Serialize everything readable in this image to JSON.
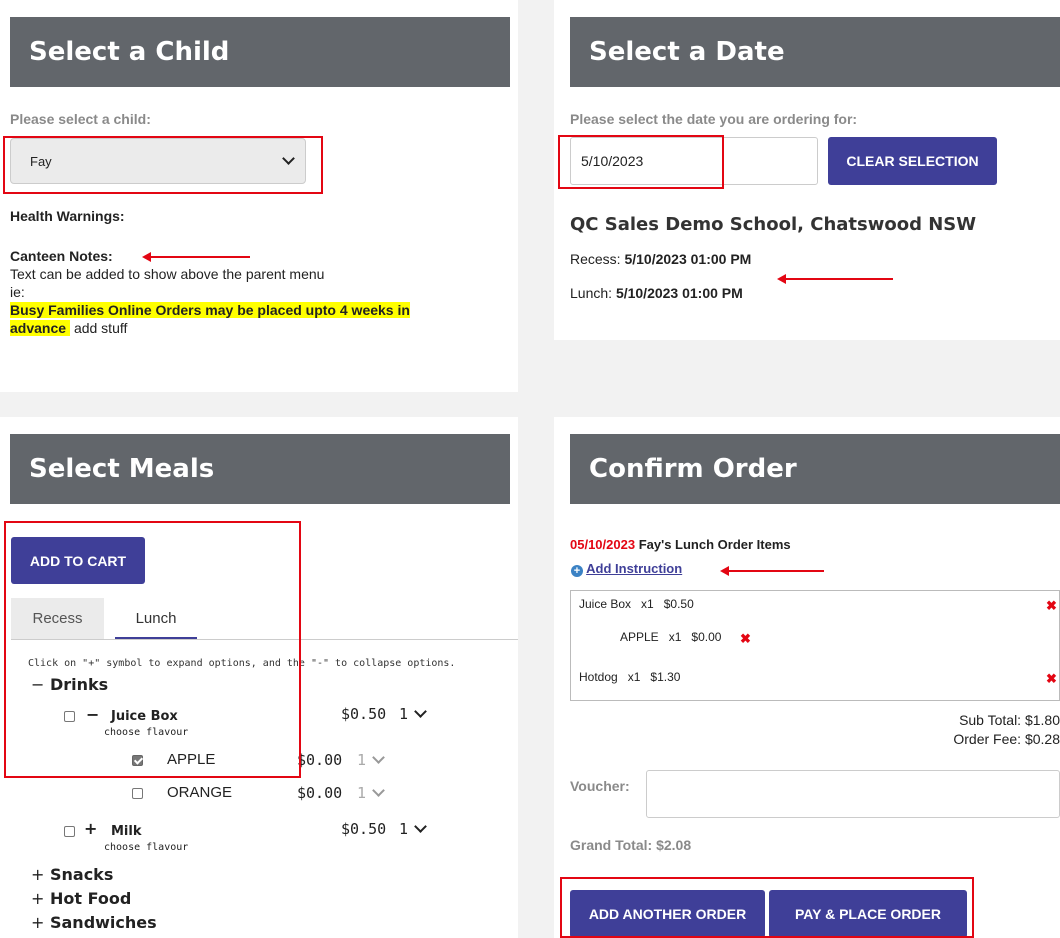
{
  "child_panel": {
    "title": "Select a Child",
    "prompt": "Please select a child:",
    "selected_child": "Fay",
    "health_label": "Health Warnings:",
    "notes_label": "Canteen Notes:",
    "notes_line1": "Text can be added to show above the parent menu",
    "notes_line2": "ie:",
    "highlight_line1": "Busy Families Online Orders may be placed upto 4 weeks in",
    "highlight_line2": "advance",
    "notes_tail": "add stuff"
  },
  "date_panel": {
    "title": "Select a Date",
    "prompt": "Please select the date you are ordering for:",
    "date_value": "5/10/2023",
    "clear_label": "CLEAR SELECTION",
    "school": "QC Sales Demo School, Chatswood NSW",
    "recess_label": "Recess:",
    "recess_value": "5/10/2023 01:00 PM",
    "lunch_label": "Lunch:",
    "lunch_value": "5/10/2023 01:00 PM"
  },
  "meals_panel": {
    "title": "Select Meals",
    "add_to_cart": "ADD TO CART",
    "tabs": [
      "Recess",
      "Lunch"
    ],
    "instructions": "Click on \"+\" symbol to expand options, and the \"-\" to collapse options.",
    "drinks": "Drinks",
    "juice": "Juice Box",
    "juice_price": "$0.50",
    "juice_qty": "1",
    "choose_flavour": "choose flavour",
    "apple": "APPLE",
    "apple_price": "$0.00",
    "apple_qty": "1",
    "orange": "ORANGE",
    "orange_price": "$0.00",
    "orange_qty": "1",
    "milk": "Milk",
    "milk_price": "$0.50",
    "milk_qty": "1",
    "snacks": "Snacks",
    "hot_food": "Hot Food",
    "sandwiches": "Sandwiches",
    "minus": "−",
    "plus": "+"
  },
  "confirm_panel": {
    "title": "Confirm Order",
    "order_date": "05/10/2023",
    "order_label": "Fay's Lunch Order Items",
    "add_instruction": "Add Instruction",
    "lines": [
      {
        "name": "Juice Box",
        "qty": "x1",
        "price": "$0.50"
      },
      {
        "name": "APPLE",
        "qty": "x1",
        "price": "$0.00"
      },
      {
        "name": "Hotdog",
        "qty": "x1",
        "price": "$1.30"
      }
    ],
    "remove_glyph": "✖",
    "subtotal": "Sub Total: $1.80",
    "order_fee": "Order Fee: $0.28",
    "voucher_label": "Voucher:",
    "voucher_value": "",
    "grand_total": "Grand Total: $2.08",
    "add_another": "ADD ANOTHER ORDER",
    "pay_place": "PAY & PLACE ORDER"
  },
  "colors": {
    "accent": "#3f3f98",
    "header": "#62666b",
    "annotation": "#e30613",
    "highlight": "#ffff00"
  }
}
